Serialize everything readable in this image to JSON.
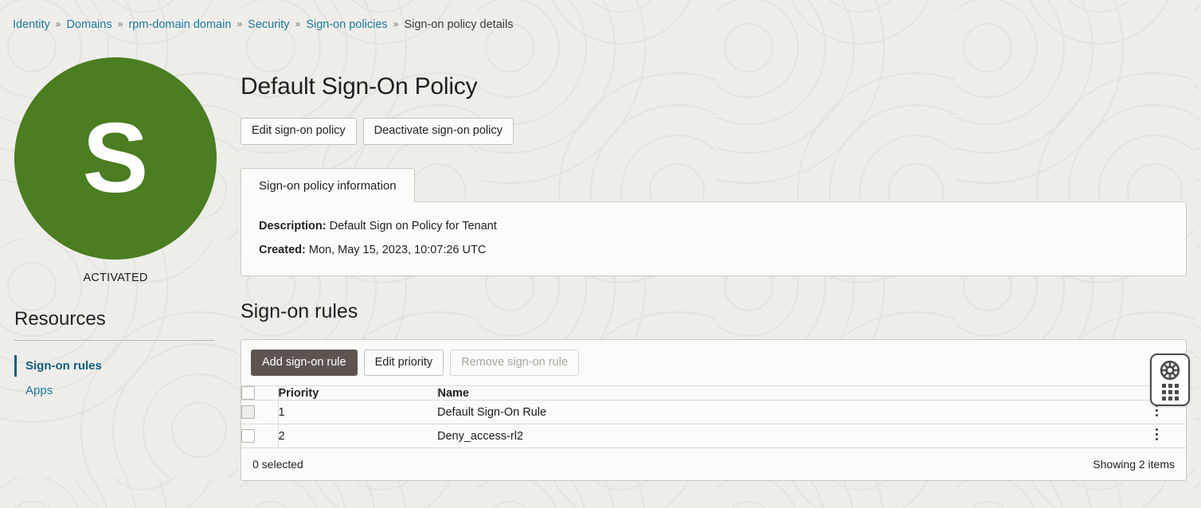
{
  "breadcrumb": {
    "separator": "»",
    "items": [
      {
        "label": "Identity",
        "link": true
      },
      {
        "label": "Domains",
        "link": true
      },
      {
        "label": "rpm-domain domain",
        "link": true
      },
      {
        "label": "Security",
        "link": true
      },
      {
        "label": "Sign-on policies",
        "link": true
      },
      {
        "label": "Sign-on policy details",
        "link": false
      }
    ]
  },
  "sidebar": {
    "avatar": {
      "initial": "S",
      "color": "#4b7d21",
      "status": "ACTIVATED"
    },
    "resources_title": "Resources",
    "items": [
      {
        "label": "Sign-on rules",
        "active": true
      },
      {
        "label": "Apps",
        "active": false
      }
    ]
  },
  "page": {
    "title": "Default Sign-On Policy",
    "actions": [
      {
        "label": "Edit sign-on policy",
        "style": "default"
      },
      {
        "label": "Deactivate sign-on policy",
        "style": "default"
      }
    ]
  },
  "tabs": [
    {
      "label": "Sign-on policy information",
      "active": true
    }
  ],
  "policy_info": [
    {
      "label": "Description:",
      "value": "Default Sign on Policy for Tenant"
    },
    {
      "label": "Created:",
      "value": "Mon, May 15, 2023, 10:07:26 UTC"
    }
  ],
  "rules_section": {
    "title": "Sign-on rules",
    "toolbar": [
      {
        "label": "Add sign-on rule",
        "style": "primary",
        "disabled": false
      },
      {
        "label": "Edit priority",
        "style": "default",
        "disabled": false
      },
      {
        "label": "Remove sign-on rule",
        "style": "disabled",
        "disabled": true
      }
    ],
    "columns": [
      "Priority",
      "Name"
    ],
    "rows": [
      {
        "priority": "1",
        "name": "Default Sign-On Rule",
        "checked": false
      },
      {
        "priority": "2",
        "name": "Deny_access-rl2",
        "checked": false
      }
    ],
    "footer": {
      "selected": "0 selected",
      "showing": "Showing 2 items"
    }
  },
  "help_widget": {
    "icon": "life-ring-icon",
    "handle": "drag-handle-dots"
  },
  "colors": {
    "background": "#eeedea",
    "card": "#fbfbfa",
    "link": "#1d7a9c",
    "link_active": "#11607e",
    "primary_button": "#5d5450",
    "avatar_green": "#4b7d21",
    "border": "#c9c7c2"
  }
}
